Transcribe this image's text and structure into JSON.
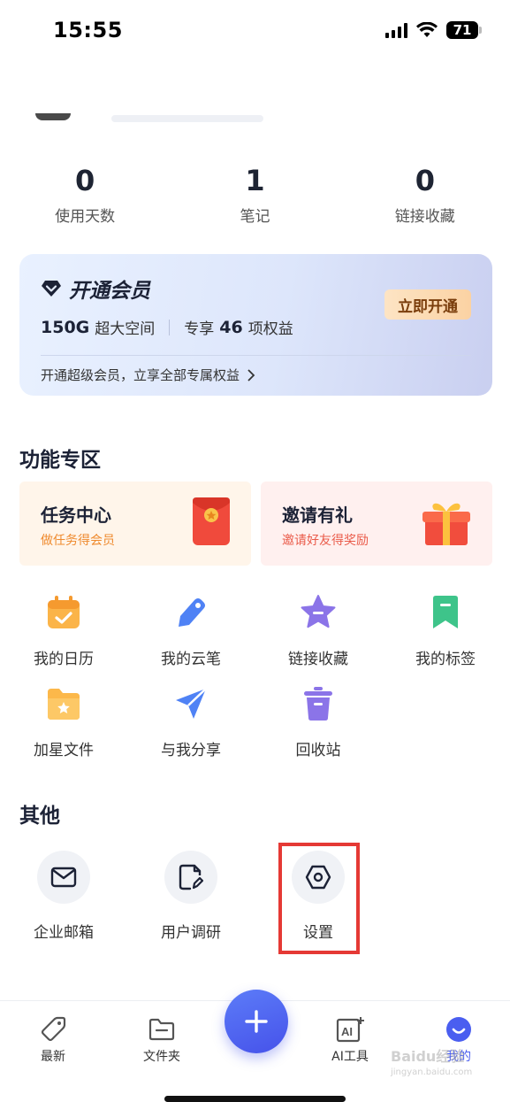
{
  "status_bar": {
    "time": "15:55",
    "battery": "71"
  },
  "stats": [
    {
      "value": "0",
      "label": "使用天数"
    },
    {
      "value": "1",
      "label": "笔记"
    },
    {
      "value": "0",
      "label": "链接收藏"
    }
  ],
  "vip": {
    "title": "开通会员",
    "storage_bold": "150G",
    "storage_text": "超大空间",
    "benefit_prefix": "专享",
    "benefit_bold": "46",
    "benefit_suffix": "项权益",
    "link_text": "开通超级会员，立享全部专属权益",
    "button_label": "立即开通"
  },
  "features_section": {
    "title": "功能专区",
    "promos": [
      {
        "title": "任务中心",
        "subtitle": "做任务得会员"
      },
      {
        "title": "邀请有礼",
        "subtitle": "邀请好友得奖励"
      }
    ],
    "items": [
      {
        "label": "我的日历",
        "icon": "calendar-icon"
      },
      {
        "label": "我的云笔",
        "icon": "pen-icon"
      },
      {
        "label": "链接收藏",
        "icon": "star-icon"
      },
      {
        "label": "我的标签",
        "icon": "bookmark-icon"
      },
      {
        "label": "加星文件",
        "icon": "star-folder-icon"
      },
      {
        "label": "与我分享",
        "icon": "send-icon"
      },
      {
        "label": "回收站",
        "icon": "trash-icon"
      }
    ]
  },
  "others_section": {
    "title": "其他",
    "items": [
      {
        "label": "企业邮箱",
        "icon": "mail-icon"
      },
      {
        "label": "用户调研",
        "icon": "survey-icon"
      },
      {
        "label": "设置",
        "icon": "settings-icon"
      }
    ]
  },
  "bottom_nav": {
    "items": [
      {
        "label": "最新",
        "icon": "tag-icon"
      },
      {
        "label": "文件夹",
        "icon": "folder-icon"
      },
      {
        "label": "AI工具",
        "icon": "ai-icon"
      },
      {
        "label": "我的",
        "icon": "profile-icon"
      }
    ],
    "active": "我的"
  },
  "watermark": {
    "text": "Baidu经验",
    "sub": "jingyan.baidu.com"
  },
  "colors": {
    "accent": "#4a5ef0",
    "highlight": "#e53935"
  }
}
